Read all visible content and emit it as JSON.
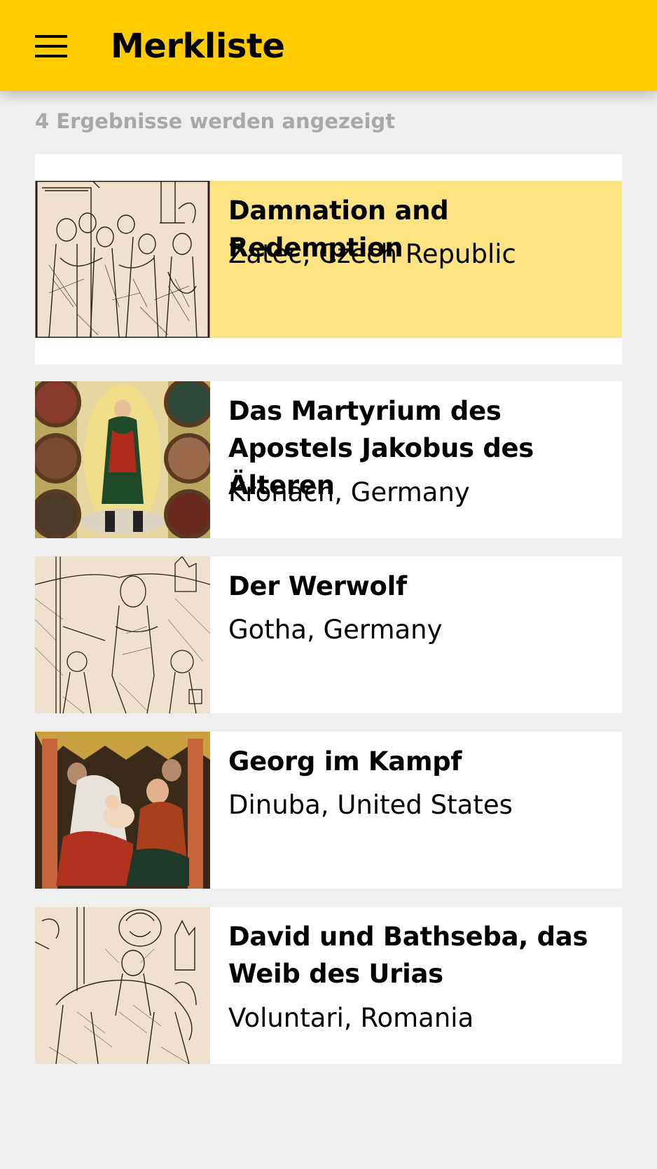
{
  "appbar": {
    "title": "Merkliste",
    "menu_icon": "hamburger-menu-icon",
    "color": "#ffcc00"
  },
  "results": {
    "count_text": "4 Ergebnisse werden angezeigt"
  },
  "items": [
    {
      "title": "Damnation and Redemption",
      "location": "Žatec, Czech Republic",
      "selected": true,
      "image": "woodcut-engraving-crowd"
    },
    {
      "title": "Das Martyrium des Apostels Jakobus des Älteren",
      "location": "Kronach, Germany",
      "selected": false,
      "image": "painting-madonna-roundels"
    },
    {
      "title": "Der Werwolf",
      "location": "Gotha, Germany",
      "selected": false,
      "image": "woodcut-knight-figures"
    },
    {
      "title": "Georg im Kampf",
      "location": "Dinuba, United States",
      "selected": false,
      "image": "painting-holy-family"
    },
    {
      "title": "David und Bathseba, das Weib des Urias",
      "location": "Voluntari, Romania",
      "selected": false,
      "image": "woodcut-horseman"
    }
  ],
  "colors": {
    "selected_background": "#fde381",
    "page_background": "#efefef",
    "card_background": "#ffffff",
    "muted_text": "#a8a8a8"
  }
}
